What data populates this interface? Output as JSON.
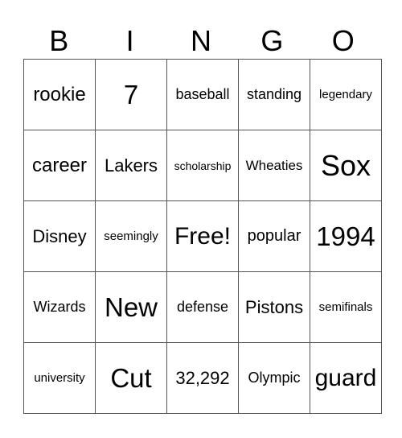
{
  "header": [
    "B",
    "I",
    "N",
    "G",
    "O"
  ],
  "rows": [
    [
      "rookie",
      "7",
      "baseball",
      "standing",
      "legendary"
    ],
    [
      "career",
      "Lakers",
      "scholarship",
      "Wheaties",
      "Sox"
    ],
    [
      "Disney",
      "seemingly",
      "Free!",
      "popular",
      "1994"
    ],
    [
      "Wizards",
      "New",
      "defense",
      "Pistons",
      "semifinals"
    ],
    [
      "university",
      "Cut",
      "32,292",
      "Olympic",
      "guard"
    ]
  ]
}
